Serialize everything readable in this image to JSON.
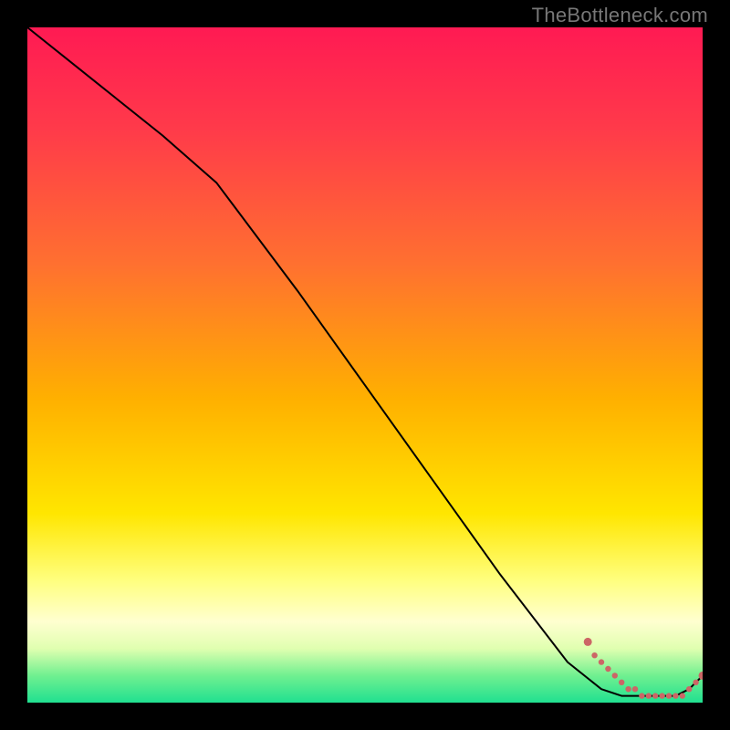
{
  "watermark": "TheBottleneck.com",
  "chart_data": {
    "type": "line",
    "title": "",
    "xlabel": "",
    "ylabel": "",
    "xlim": [
      0,
      100
    ],
    "ylim": [
      0,
      100
    ],
    "series": [
      {
        "name": "curve",
        "style": "solid",
        "color": "#000000",
        "x": [
          0,
          10,
          20,
          28,
          40,
          50,
          60,
          70,
          80,
          85,
          88,
          90,
          92,
          94,
          96,
          98,
          100
        ],
        "values": [
          100,
          92,
          84,
          77,
          61,
          47,
          33,
          19,
          6,
          2,
          1,
          1,
          1,
          1,
          1,
          2,
          4
        ]
      },
      {
        "name": "markers",
        "style": "points",
        "color": "#cc6666",
        "x": [
          83,
          84,
          85,
          86,
          87,
          88,
          89,
          90,
          91,
          92,
          93,
          94,
          95,
          96,
          97,
          98,
          99,
          100
        ],
        "values": [
          9,
          7,
          6,
          5,
          4,
          3,
          2,
          2,
          1,
          1,
          1,
          1,
          1,
          1,
          1,
          2,
          3,
          4
        ]
      }
    ]
  }
}
